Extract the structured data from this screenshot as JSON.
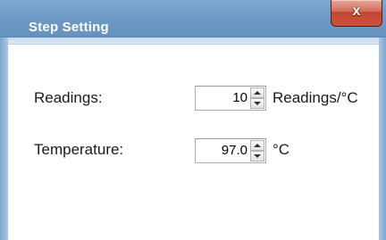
{
  "window": {
    "title": "Step Setting",
    "close_label": "x"
  },
  "fields": [
    {
      "label": "Readings:",
      "value": "10",
      "unit": "Readings/°C"
    },
    {
      "label": "Temperature:",
      "value": "97.0",
      "unit": "°C"
    }
  ],
  "icons": {
    "close": "close-icon",
    "spin_up": "chevron-up-icon",
    "spin_down": "chevron-down-icon"
  },
  "colors": {
    "titlebar": "#6c99c4",
    "close_button": "#c9533b",
    "title_text": "#ffffff"
  }
}
